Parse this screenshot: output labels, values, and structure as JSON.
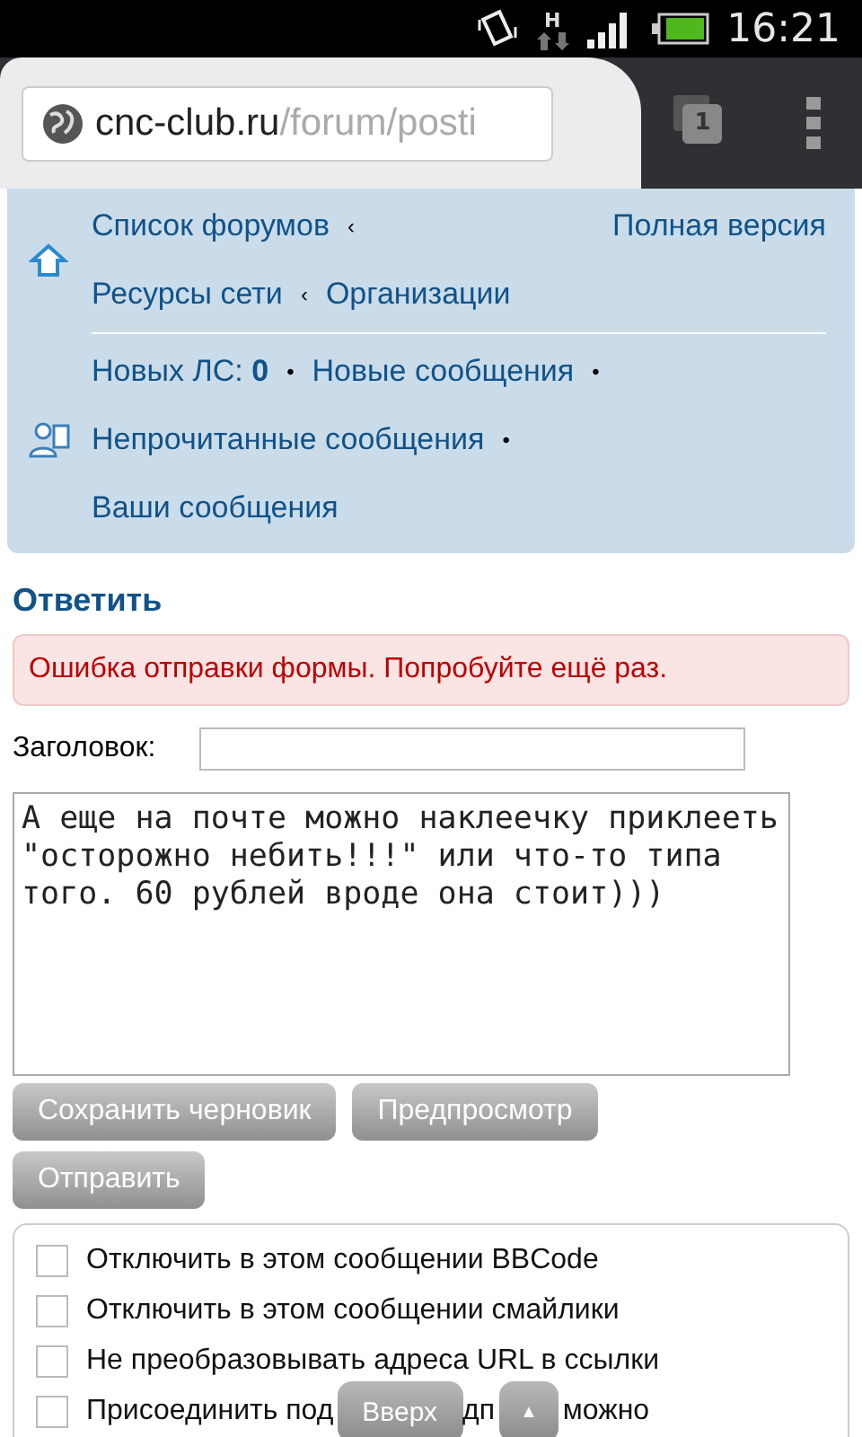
{
  "status_bar": {
    "network": "H",
    "time": "16:21"
  },
  "browser": {
    "url_host": "cnc-club.ru",
    "url_path": "/forum/posti",
    "tab_count": "1"
  },
  "nav": {
    "row1": [
      {
        "text": "Список форумов"
      },
      {
        "text": "‹"
      }
    ],
    "full_version": "Полная версия",
    "row2": [
      {
        "text": "Ресурсы сети"
      },
      {
        "text": "‹"
      },
      {
        "text": "Организации"
      }
    ],
    "pm_label": "Новых ЛС:",
    "pm_count": "0",
    "sep": "•",
    "new_posts": "Новые сообщения",
    "unread": "Непрочитанные сообщения",
    "your_posts": "Ваши сообщения"
  },
  "heading": "Ответить",
  "error": "Ошибка отправки формы. Попробуйте ещё раз.",
  "subject": {
    "label": "Заголовок:"
  },
  "message": "А еще на почте можно наклеечку приклееть \"осторожно небить!!!\" или что-то типа того. 60 рублей вроде она стоит)))",
  "buttons": [
    "Сохранить черновик",
    "Предпросмотр",
    "Отправить"
  ],
  "options": [
    {
      "label": "Отключить в этом сообщении BBCode",
      "checked": false
    },
    {
      "label": "Отключить в этом сообщении смайлики",
      "checked": false
    },
    {
      "label": "Не преобразовывать адреса URL в ссылки",
      "checked": false
    },
    {
      "label_parts": [
        "Присоединить под",
        "дп",
        "можно"
      ],
      "checked": false
    }
  ],
  "float_buttons": {
    "top": "Вверх",
    "arrow": "▲"
  }
}
